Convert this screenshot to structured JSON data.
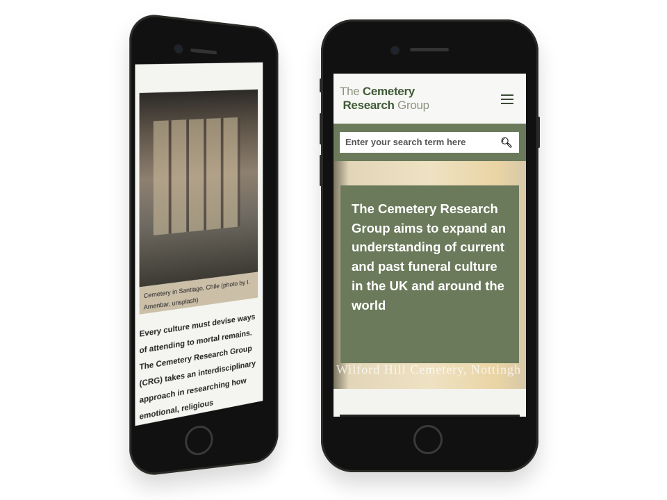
{
  "right_phone": {
    "logo": {
      "word1": "The",
      "word2": "Cemetery",
      "word3": "Research",
      "word4": "Group"
    },
    "search": {
      "placeholder": "Enter your search term here",
      "icon": "search-icon"
    },
    "menu_icon": "hamburger-menu-icon",
    "hero": {
      "text": "The Cemetery Research Group aims to expand an understanding of current and past funeral culture in the UK and around the world",
      "image_caption": "Wilford Hill Cemetery, Nottingh"
    },
    "colors": {
      "accent": "#6b7a5b",
      "logo_dark": "#3e5a35"
    }
  },
  "left_phone": {
    "photo_caption": "Cemetery in Santiago, Chile (photo by I. Amenbar, unsplash)",
    "body": "Every culture must devise ways of attending to mortal remains. The Cemetery Research Group (CRG) takes an interdisciplinary approach in researching how emotional, religious"
  }
}
